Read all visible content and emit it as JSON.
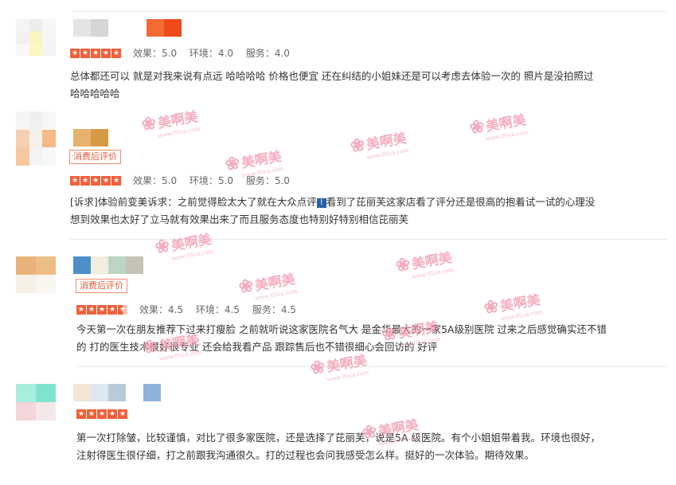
{
  "reviews": [
    {
      "stars": 5,
      "scores": {
        "effect": "效果：5.0",
        "env": "环境：4.0",
        "service": "服务：4.0"
      },
      "text_lines": [
        "总体都还可以 就是对我来说有点远 哈哈哈哈 价格也便宜 还在纠结的小姐妹还是可以考虑去体验一次的 照片是没拍照过",
        "哈哈哈哈哈"
      ]
    },
    {
      "badge": "消费后评价",
      "stars": 5,
      "scores": {
        "effect": "效果：5.0",
        "env": "环境：5.0",
        "service": "服务：5.0"
      },
      "text_line1_before": "[诉求]体验前变美诉求：之前觉得脸太大了就在大众点评",
      "text_line1_after": "看到了芘丽芙这家店看了评分还是很高的抱着试一试的心理没",
      "text_line2": "想到效果也太好了立马就有效果出来了而且服务态度也特别好特别相信芘丽芙"
    },
    {
      "badge": "消费后评价",
      "stars": 4.5,
      "scores": {
        "effect": "效果：4.5",
        "env": "环境：4.5",
        "service": "服务：4.5"
      },
      "text_lines": [
        "今天第一次在朋友推荐下过来打瘦脸 之前就听说这家医院名气大 是金华最大的一家5A级别医院 过来之后感觉确实还不错",
        "的 打的医生技术很好很专业 还会给我看产品 跟踪售后也不错很细心会回访的 好评"
      ]
    },
    {
      "stars": 5,
      "text_lines": [
        "第一次打除皱，比较谨慎，对比了很多家医院，还是选择了芘丽芙，说是5A 级医院。有个小姐姐带着我。环境也很好，",
        "注射得医生很仔细，打之前跟我沟通很久。打的过程也会问我感受怎么样。挺好的一次体验。期待效果。"
      ]
    }
  ],
  "watermark": {
    "text": "美啊美",
    "sub": "www.05ca.com"
  },
  "icons": {
    "star": "star-icon",
    "flag": "flag-icon"
  },
  "colors": {
    "accent": "#f2603a",
    "badge_border": "#f08a6e",
    "watermark": "#f29bb2"
  }
}
